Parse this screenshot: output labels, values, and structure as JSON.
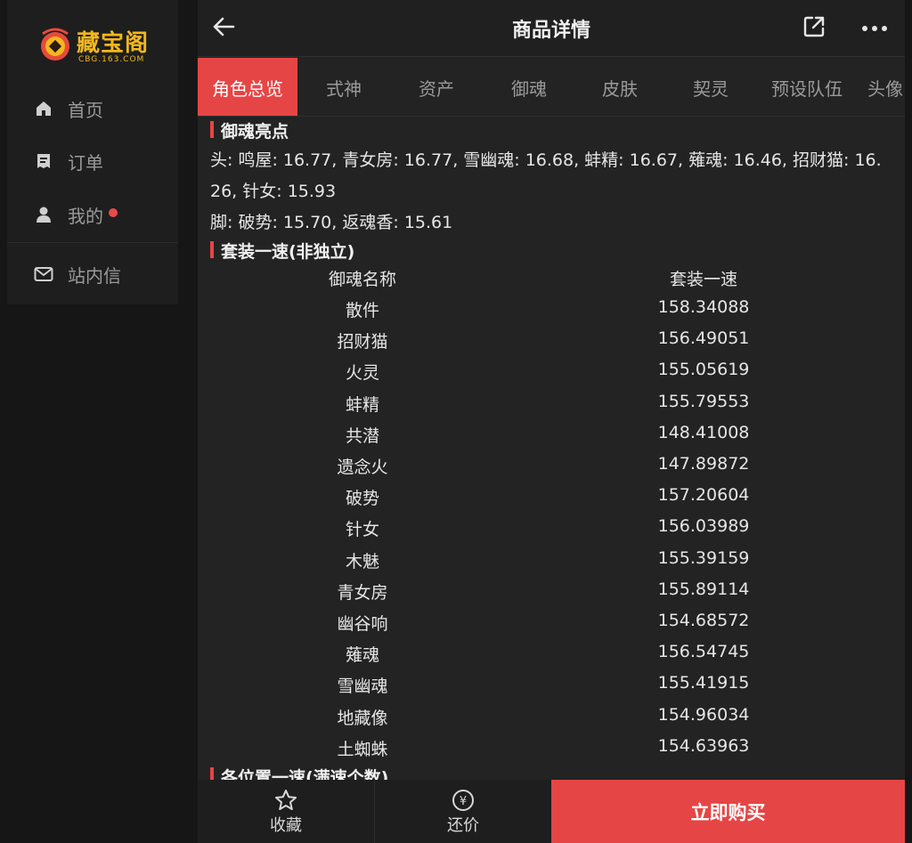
{
  "brand": {
    "name": "藏宝阁",
    "domain": "CBG.163.COM",
    "color": "#f2b81d"
  },
  "sidebar": {
    "items": [
      {
        "label": "首页",
        "icon": "home-icon"
      },
      {
        "label": "订单",
        "icon": "order-icon"
      },
      {
        "label": "我的",
        "icon": "user-icon",
        "has_dot": true
      },
      {
        "label": "站内信",
        "icon": "mail-icon"
      }
    ]
  },
  "header": {
    "title": "商品详情"
  },
  "tabs": [
    {
      "label": "角色总览",
      "active": true
    },
    {
      "label": "式神"
    },
    {
      "label": "资产"
    },
    {
      "label": "御魂"
    },
    {
      "label": "皮肤"
    },
    {
      "label": "契灵"
    },
    {
      "label": "预设队伍"
    },
    {
      "label": "头像"
    }
  ],
  "highlights": {
    "title": "御魂亮点",
    "line1": "头: 鸣屋: 16.77, 青女房: 16.77, 雪幽魂: 16.68, 蚌精: 16.67, 薙魂: 16.46, 招财猫: 16.",
    "line2": "26, 针女: 15.93",
    "line3": "脚: 破势: 15.70, 返魂香: 15.61"
  },
  "suit_speed": {
    "title": "套装一速(非独立)",
    "columns": [
      "御魂名称",
      "套装一速"
    ],
    "rows": [
      [
        "散件",
        "158.34088"
      ],
      [
        "招财猫",
        "156.49051"
      ],
      [
        "火灵",
        "155.05619"
      ],
      [
        "蚌精",
        "155.79553"
      ],
      [
        "共潜",
        "148.41008"
      ],
      [
        "遗念火",
        "147.89872"
      ],
      [
        "破势",
        "157.20604"
      ],
      [
        "针女",
        "156.03989"
      ],
      [
        "木魅",
        "155.39159"
      ],
      [
        "青女房",
        "155.89114"
      ],
      [
        "幽谷响",
        "154.68572"
      ],
      [
        "薙魂",
        "156.54745"
      ],
      [
        "雪幽魂",
        "155.41915"
      ],
      [
        "地藏像",
        "154.96034"
      ],
      [
        "土蜘蛛",
        "154.63963"
      ]
    ]
  },
  "next_section": {
    "title": "各位置一速(满速个数)"
  },
  "bottom_bar": {
    "favorite_label": "收藏",
    "bargain_label": "还价",
    "bargain_icon_char": "¥",
    "buy_label": "立即购买"
  },
  "colors": {
    "accent": "#e64545",
    "panel": "#232323",
    "sidebar": "#1e1e1e",
    "background": "#161616"
  }
}
